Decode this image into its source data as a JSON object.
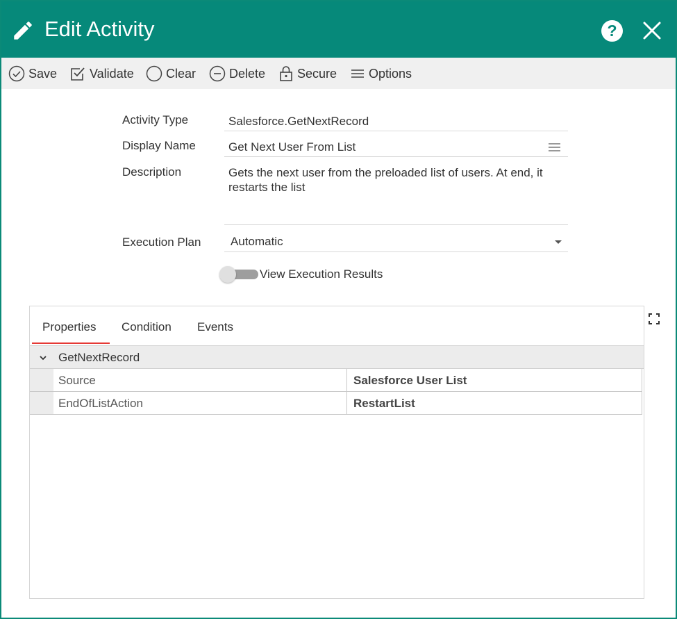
{
  "header": {
    "title": "Edit Activity",
    "help_label": "?",
    "bg_color": "#06897a"
  },
  "toolbar": {
    "save": "Save",
    "validate": "Validate",
    "clear": "Clear",
    "delete": "Delete",
    "secure": "Secure",
    "options": "Options"
  },
  "form": {
    "activity_type_label": "Activity Type",
    "activity_type_value": "Salesforce.GetNextRecord",
    "display_name_label": "Display Name",
    "display_name_value": "Get Next User From List",
    "description_label": "Description",
    "description_line1": "Gets the next user from the preloaded list of users.  At end, it",
    "description_line2": "restarts the list",
    "execution_plan_label": "Execution Plan",
    "execution_plan_value": "Automatic",
    "view_results_label": "View Execution Results",
    "view_results_on": false
  },
  "panel": {
    "tabs": [
      {
        "label": "Properties",
        "active": true
      },
      {
        "label": "Condition",
        "active": false
      },
      {
        "label": "Events",
        "active": false
      }
    ],
    "group_name": "GetNextRecord",
    "rows": [
      {
        "name": "Source",
        "value": "Salesforce User List"
      },
      {
        "name": "EndOfListAction",
        "value": "RestartList"
      }
    ]
  }
}
